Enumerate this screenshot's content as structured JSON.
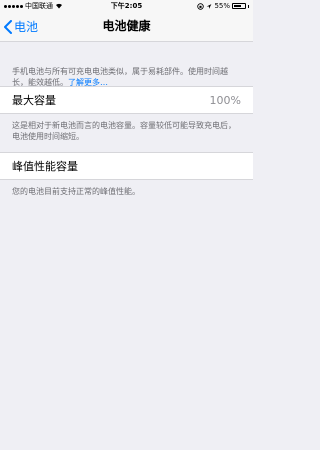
{
  "status_bar": {
    "carrier": "中国联通",
    "time": "下午2:05",
    "battery": "55%"
  },
  "nav": {
    "back_label": "电池",
    "title": "电池健康"
  },
  "intro": {
    "text": "手机电池与所有可充电电池类似，属于易耗部件。使用时间越长，能效越低。",
    "link": "了解更多…"
  },
  "max_capacity": {
    "label": "最大容量",
    "value": "100%",
    "description": "这是相对于新电池而言的电池容量。容量较低可能导致充电后，电池使用时间缩短。"
  },
  "peak_performance": {
    "label": "峰值性能容量",
    "description": "您的电池目前支持正常的峰值性能。"
  }
}
